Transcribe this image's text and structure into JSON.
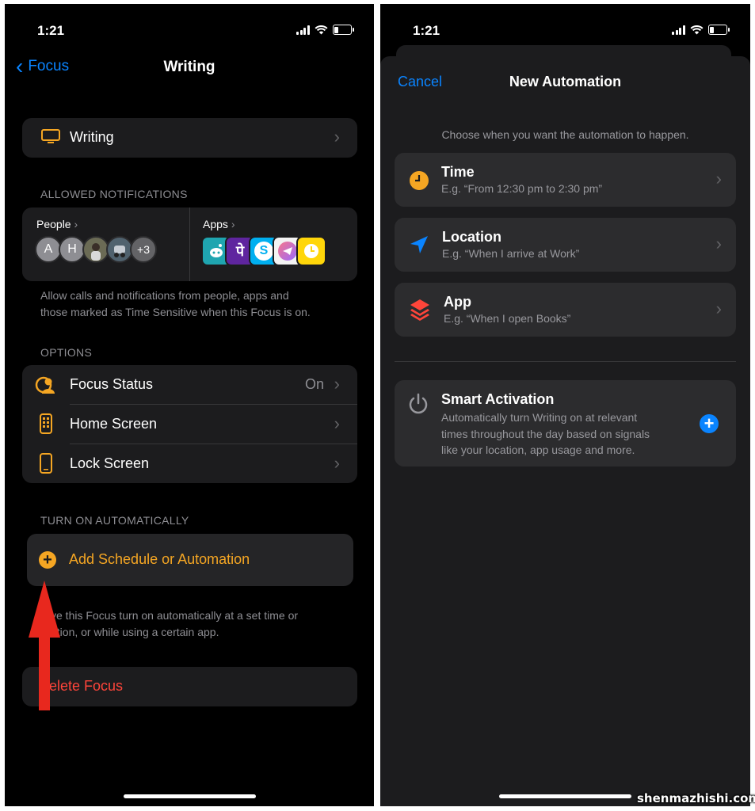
{
  "left": {
    "status": {
      "time": "1:21"
    },
    "nav": {
      "back_label": "Focus",
      "title": "Writing"
    },
    "focus_name": "Writing",
    "allowed_header": "ALLOWED NOTIFICATIONS",
    "people": {
      "label": "People",
      "avatars": [
        "A",
        "H"
      ],
      "more": "+3"
    },
    "apps": {
      "label": "Apps",
      "icons": [
        "reddit-app-icon",
        "phonepe-app-icon",
        "skype-app-icon",
        "telegram-app-icon",
        "clock-app-icon"
      ]
    },
    "allowed_note": [
      "Allow calls and notifications from people, apps and",
      "those marked as Time Sensitive when this Focus is on."
    ],
    "options_header": "OPTIONS",
    "options": [
      {
        "label": "Focus Status",
        "value": "On"
      },
      {
        "label": "Home Screen"
      },
      {
        "label": "Lock Screen"
      }
    ],
    "auto_header": "TURN ON AUTOMATICALLY",
    "add_schedule": "Add Schedule or Automation",
    "auto_note": [
      "ve this Focus turn on automatically at a set time or",
      "ation, or while using a certain app."
    ],
    "delete": "elete Focus"
  },
  "right": {
    "status": {
      "time": "1:21"
    },
    "nav": {
      "cancel": "Cancel",
      "title": "New Automation"
    },
    "prompt": "Choose when you want the automation to happen.",
    "triggers": [
      {
        "title": "Time",
        "subtitle": "E.g. “From 12:30 pm to 2:30 pm”",
        "icon": "clock-icon"
      },
      {
        "title": "Location",
        "subtitle": "E.g. “When I arrive at Work”",
        "icon": "location-arrow-icon"
      },
      {
        "title": "App",
        "subtitle": "E.g. “When I open Books”",
        "icon": "layers-icon"
      }
    ],
    "smart": {
      "title": "Smart Activation",
      "lines": [
        "Automatically turn Writing on at relevant",
        "times throughout the day based on signals",
        "like your location, app usage and more."
      ]
    }
  },
  "watermark": "shenmazhishi.com",
  "colors": {
    "accent_blue": "#0a84ff",
    "accent_orange": "#f5a623",
    "destructive": "#ff453a",
    "annotation_arrow": "#e8281e"
  }
}
